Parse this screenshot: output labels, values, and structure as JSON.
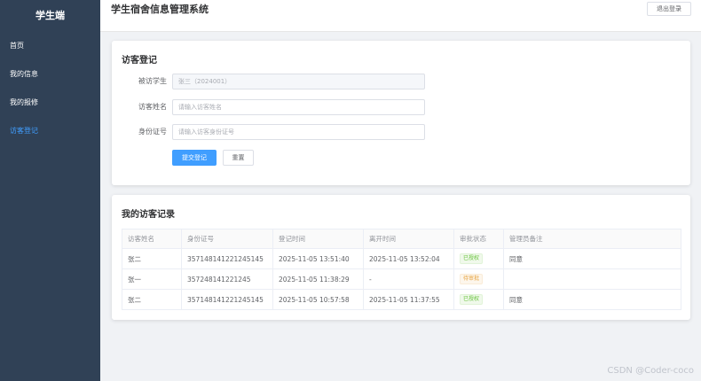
{
  "sidebar": {
    "title": "学生端",
    "items": [
      {
        "label": "首页"
      },
      {
        "label": "我的信息"
      },
      {
        "label": "我的报修"
      },
      {
        "label": "访客登记",
        "active": true
      }
    ]
  },
  "header": {
    "title": "学生宿舍信息管理系统",
    "logout_label": "退出登录"
  },
  "form": {
    "title": "访客登记",
    "student_label": "被访学生",
    "student_value": "张三（2024001）",
    "name_label": "访客姓名",
    "name_placeholder": "请输入访客姓名",
    "id_label": "身份证号",
    "id_placeholder": "请输入访客身份证号",
    "submit_label": "提交登记",
    "reset_label": "重置"
  },
  "records": {
    "title": "我的访客记录",
    "columns": [
      "访客姓名",
      "身份证号",
      "登记时间",
      "离开时间",
      "审批状态",
      "管理员备注"
    ],
    "rows": [
      {
        "name": "张二",
        "id": "357148141221245145",
        "checkin": "2025-11-05 13:51:40",
        "checkout": "2025-11-05 13:52:04",
        "status": "已授权",
        "status_type": "success",
        "remark": "同意"
      },
      {
        "name": "张一",
        "id": "357248141221245",
        "checkin": "2025-11-05 11:38:29",
        "checkout": "-",
        "status": "待审批",
        "status_type": "warning",
        "remark": ""
      },
      {
        "name": "张二",
        "id": "357148141221245145",
        "checkin": "2025-11-05 10:57:58",
        "checkout": "2025-11-05 11:37:55",
        "status": "已授权",
        "status_type": "success",
        "remark": "同意"
      }
    ]
  },
  "watermark": "CSDN @Coder-coco",
  "colors": {
    "sidebar_bg": "#304156",
    "accent": "#409eff",
    "success": "#67c23a",
    "warning": "#e6a23c"
  }
}
